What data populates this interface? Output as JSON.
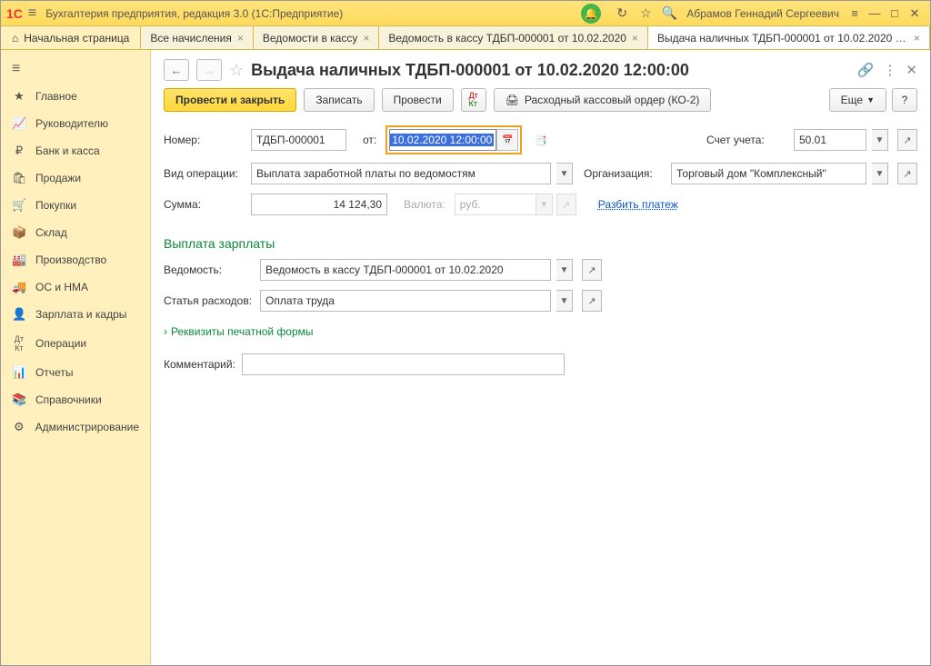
{
  "app": {
    "logo": "1C",
    "title": "Бухгалтерия предприятия, редакция 3.0  (1С:Предприятие)",
    "user": "Абрамов Геннадий Сергеевич"
  },
  "tabs": {
    "home": "Начальная страница",
    "t1": "Все начисления",
    "t2": "Ведомости в кассу",
    "t3": "Ведомость в кассу ТДБП-000001 от 10.02.2020",
    "t4": "Выдача наличных ТДБП-000001 от 10.02.2020 12:00:00"
  },
  "sidebar": {
    "main": "Главное",
    "ruk": "Руководителю",
    "bank": "Банк и касса",
    "prod": "Продажи",
    "pok": "Покупки",
    "sklad": "Склад",
    "proizv": "Производство",
    "os": "ОС и НМА",
    "zarp": "Зарплата и кадры",
    "oper": "Операции",
    "otch": "Отчеты",
    "sprav": "Справочники",
    "admin": "Администрирование"
  },
  "doc": {
    "title": "Выдача наличных ТДБП-000001 от 10.02.2020 12:00:00",
    "provesti_zakryt": "Провести и закрыть",
    "zapisat": "Записать",
    "provesti": "Провести",
    "print_ko2": "Расходный кассовый ордер (КО-2)",
    "more": "Еще",
    "help": "?",
    "labels": {
      "nomer": "Номер:",
      "ot": "от:",
      "vid": "Вид операции:",
      "summa": "Сумма:",
      "valuta": "Валюта:",
      "schet": "Счет учета:",
      "org": "Организация:",
      "razbit": "Разбить платеж",
      "vedom": "Ведомость:",
      "statya": "Статья расходов:",
      "rekv": "Реквизиты печатной формы",
      "kom": "Комментарий:"
    },
    "values": {
      "nomer": "ТДБП-000001",
      "date": "10.02.2020 12:00:00",
      "vid": "Выплата заработной платы по ведомостям",
      "summa": "14 124,30",
      "valuta": "руб.",
      "schet": "50.01",
      "org": "Торговый дом \"Комплексный\"",
      "vedom": "Ведомость в кассу ТДБП-000001 от 10.02.2020",
      "statya": "Оплата труда"
    },
    "section": "Выплата зарплаты"
  }
}
